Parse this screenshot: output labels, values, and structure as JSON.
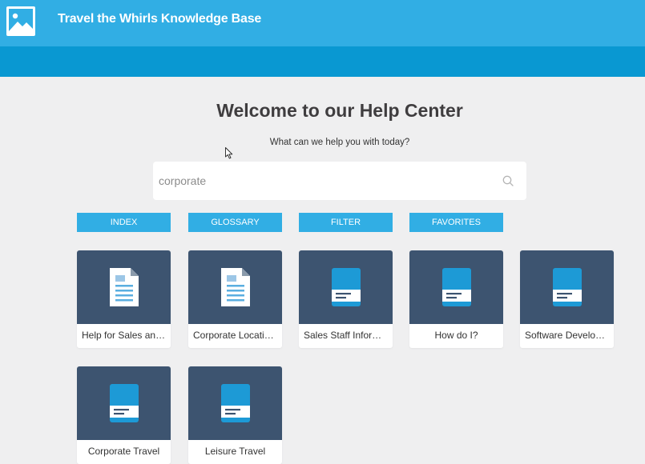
{
  "header": {
    "title": "Travel the Whirls Knowledge Base",
    "logo_icon": "image-placeholder-icon",
    "background": "#31aee4",
    "subbar_background": "#0998d2"
  },
  "main": {
    "heading": "Welcome to our Help Center",
    "subtitle": "What can we help you with today?"
  },
  "search": {
    "value": "corporate",
    "icon": "search-icon"
  },
  "nav_buttons": [
    {
      "label": "INDEX"
    },
    {
      "label": "GLOSSARY"
    },
    {
      "label": "FILTER"
    },
    {
      "label": "FAVORITES"
    }
  ],
  "cards": [
    {
      "label": "Help for Sales and Marketing",
      "icon": "document-icon"
    },
    {
      "label": "Corporate Locations",
      "icon": "document-icon"
    },
    {
      "label": "Sales Staff Information",
      "icon": "book-icon"
    },
    {
      "label": "How do I?",
      "icon": "book-icon"
    },
    {
      "label": "Software Development",
      "icon": "book-icon"
    },
    {
      "label": "Corporate Travel",
      "icon": "book-icon"
    },
    {
      "label": "Leisure Travel",
      "icon": "book-icon"
    }
  ],
  "colors": {
    "accent": "#31aee4",
    "card_thumb": "#3d5470",
    "page_background": "#efeff0"
  }
}
